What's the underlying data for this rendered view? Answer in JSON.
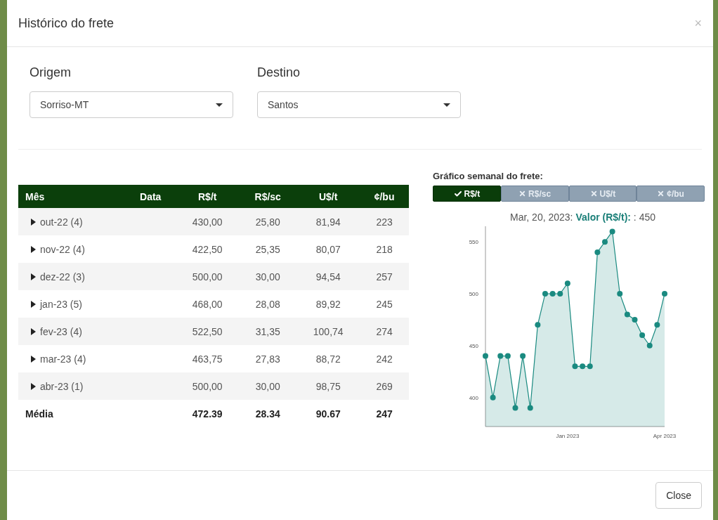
{
  "modal": {
    "title": "Histórico do frete",
    "close_icon": "×"
  },
  "filters": [
    {
      "label": "Origem",
      "value": "Sorriso-MT"
    },
    {
      "label": "Destino",
      "value": "Santos"
    }
  ],
  "table": {
    "columns": [
      "Mês",
      "Data",
      "R$/t",
      "R$/sc",
      "U$/t",
      "¢/bu"
    ],
    "rows": [
      {
        "expanded": false,
        "cells": [
          "out-22 (4)",
          "",
          "430,00",
          "25,80",
          "81,94",
          "223"
        ]
      },
      {
        "expanded": false,
        "cells": [
          "nov-22 (4)",
          "",
          "422,50",
          "25,35",
          "80,07",
          "218"
        ]
      },
      {
        "expanded": false,
        "cells": [
          "dez-22 (3)",
          "",
          "500,00",
          "30,00",
          "94,54",
          "257"
        ]
      },
      {
        "expanded": false,
        "cells": [
          "jan-23 (5)",
          "",
          "468,00",
          "28,08",
          "89,92",
          "245"
        ]
      },
      {
        "expanded": false,
        "cells": [
          "fev-23 (4)",
          "",
          "522,50",
          "31,35",
          "100,74",
          "274"
        ]
      },
      {
        "expanded": false,
        "cells": [
          "mar-23 (4)",
          "",
          "463,75",
          "27,83",
          "88,72",
          "242"
        ]
      },
      {
        "expanded": false,
        "cells": [
          "abr-23 (1)",
          "",
          "500,00",
          "30,00",
          "98,75",
          "269"
        ]
      }
    ],
    "footer": {
      "cells": [
        "Média",
        "",
        "472.39",
        "28.34",
        "90.67",
        "247"
      ]
    }
  },
  "chart_panel": {
    "title": "Gráfico semanal do frete:",
    "toggles": [
      {
        "label": "R$/t",
        "selected": true
      },
      {
        "label": "R$/sc",
        "selected": false
      },
      {
        "label": "U$/t",
        "selected": false
      },
      {
        "label": "¢/bu",
        "selected": false
      }
    ],
    "tooltip": {
      "date": "Mar, 20, 2023:",
      "label": "Valor (R$/t):",
      "value": ": 450"
    },
    "chart_data": {
      "type": "area",
      "categories": [
        null,
        null,
        null,
        null,
        null,
        null,
        null,
        null,
        null,
        null,
        null,
        "Jan 2023",
        null,
        null,
        null,
        null,
        null,
        null,
        null,
        null,
        null,
        null,
        null,
        null,
        "Apr 2023"
      ],
      "series": [
        {
          "color": "#1a8a80",
          "values": [
            440,
            400,
            440,
            440,
            390,
            440,
            390,
            470,
            500,
            500,
            500,
            510,
            430,
            430,
            430,
            540,
            550,
            560,
            500,
            480,
            475,
            460,
            450,
            470,
            500
          ]
        }
      ],
      "ylim": [
        372,
        565
      ],
      "yticks": [
        400,
        450,
        500,
        550
      ]
    }
  },
  "footer_buttons": [
    "Close"
  ]
}
